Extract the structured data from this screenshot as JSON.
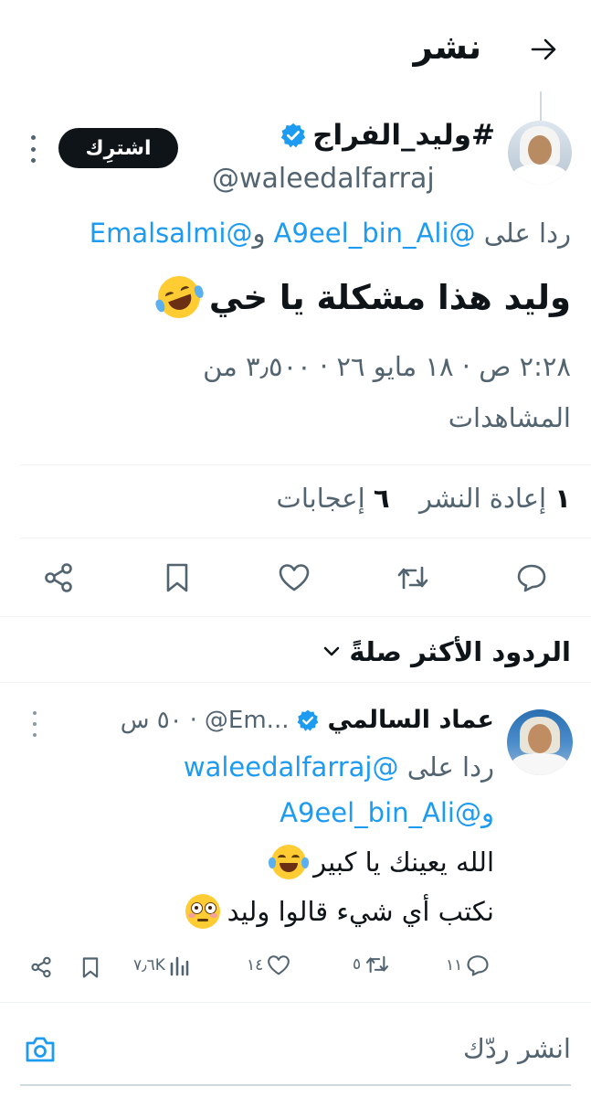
{
  "header": {
    "title": "نشر",
    "back_icon": "arrow-right-icon"
  },
  "tweet": {
    "display_name": "#وليد_الفراج",
    "handle": "@waleedalfarraj",
    "subscribe_label": "اشترِك",
    "reply_to_prefix": "ردا على",
    "reply_to_user1": "@A9eel_bin_Ali",
    "reply_to_and": "و",
    "reply_to_user2": "@Emalsalmi",
    "text": "وليد هذا مشكلة يا خي",
    "meta_line1": "٢:٢٨ ص · ١٨ مايو ٢٦ · ٣٫٥٠٠ من",
    "meta_line2": "المشاهدات",
    "reposts_count": "١",
    "reposts_label": "إعادة النشر",
    "likes_count": "٦",
    "likes_label": "إعجابات"
  },
  "actions": {
    "reply_icon": "reply-icon",
    "repost_icon": "repost-icon",
    "like_icon": "heart-icon",
    "bookmark_icon": "bookmark-icon",
    "share_icon": "share-icon"
  },
  "replies_filter": {
    "label": "الردود الأكثر صلةً"
  },
  "reply": {
    "display_name": "عماد السالمي",
    "handle": "@Em...",
    "time": "٥٠ س",
    "reply_to_prefix": "ردا على",
    "reply_to_user1": "@waleedalfarraj",
    "reply_to_and": "و",
    "reply_to_user2": "@A9eel_bin_Ali",
    "line1": "الله يعينك يا كبير",
    "line2": "نكتب أي شيء قالوا وليد",
    "replies_count": "١١",
    "reposts_count": "٥",
    "likes_count": "١٤",
    "views_count": "٧٫٦K"
  },
  "composer": {
    "placeholder": "انشر ردّك",
    "camera_icon": "camera-icon"
  },
  "colors": {
    "accent": "#1d9bf0",
    "text": "#0f1419",
    "muted": "#536471"
  }
}
